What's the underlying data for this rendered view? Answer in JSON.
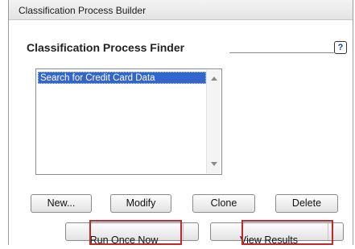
{
  "window": {
    "title": "Classification Process Builder"
  },
  "finder": {
    "title": "Classification Process Finder",
    "help_icon": "?",
    "items": [
      {
        "label": "Search for Credit Card Data",
        "selected": true
      }
    ]
  },
  "buttons": {
    "new": "New...",
    "modify": "Modify",
    "clone": "Clone",
    "delete": "Delete",
    "run_once_now": "Run Once Now",
    "view_results": "View Results"
  },
  "colors": {
    "selection": "#3366cc",
    "highlight_box": "#c0282c"
  },
  "icons": {
    "help": "question-mark-icon",
    "scroll_up": "scroll-up-arrow-icon",
    "scroll_down": "scroll-down-arrow-icon"
  }
}
